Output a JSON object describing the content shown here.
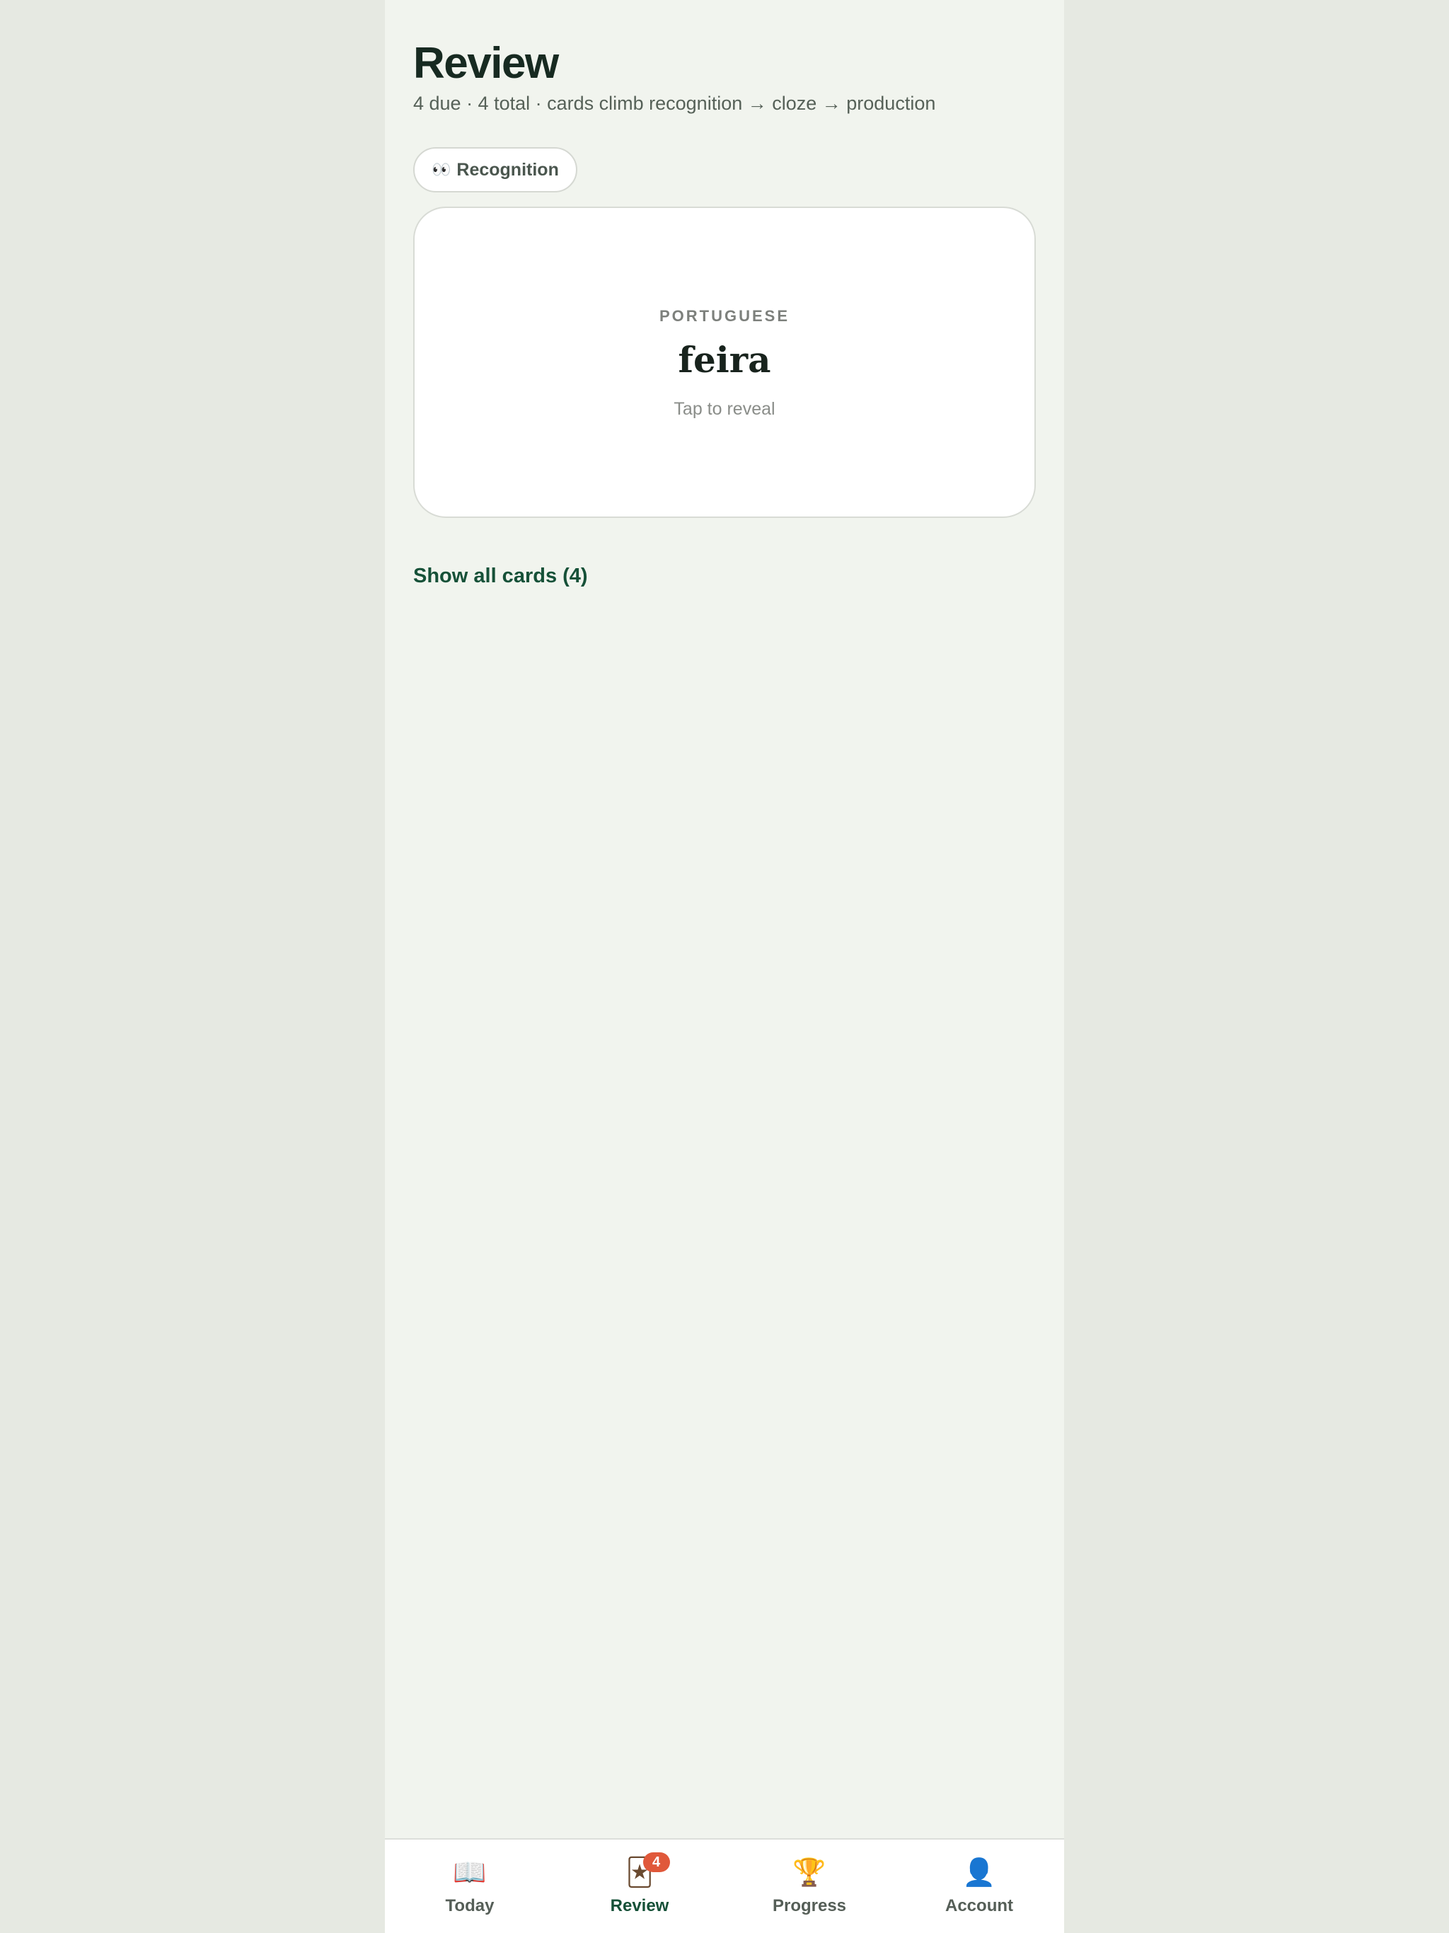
{
  "header": {
    "title": "Review",
    "subtitle": "4 due · 4 total · cards climb recognition → cloze → production"
  },
  "mode": {
    "icon": "👀",
    "icon_name": "eyes-icon",
    "label": "Recognition"
  },
  "card": {
    "language": "PORTUGUESE",
    "word": "feira",
    "hint": "Tap to reveal"
  },
  "show_all": {
    "label": "Show all cards (4)"
  },
  "tabs": [
    {
      "label": "Today",
      "icon": "📖",
      "icon_name": "open-book-icon",
      "active": false
    },
    {
      "label": "Review",
      "icon": "🃏",
      "icon_name": "playing-card-icon",
      "active": true,
      "badge": "4"
    },
    {
      "label": "Progress",
      "icon": "🏆",
      "icon_name": "trophy-icon",
      "active": false
    },
    {
      "label": "Account",
      "icon": "👤",
      "icon_name": "user-silhouette-icon",
      "active": false
    }
  ],
  "colors": {
    "accent": "#165138",
    "badge": "#e0583a",
    "background": "#f1f4ee",
    "outer_background": "#e6e9e2",
    "title": "#172a21"
  }
}
